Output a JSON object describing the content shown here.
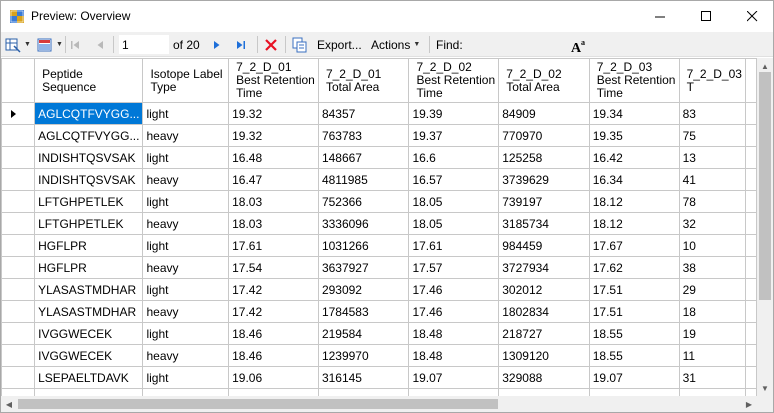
{
  "window": {
    "title": "Preview: Overview"
  },
  "toolbar": {
    "page_value": "1",
    "page_of": "of 20",
    "export_label": "Export...",
    "actions_label": "Actions",
    "find_label": "Find:"
  },
  "colors": {
    "selection": "#0078d7",
    "delete_red": "#e81123",
    "nav_blue": "#1e6fd9"
  },
  "grid": {
    "headers": [
      "Peptide Sequence",
      "Isotope Label Type",
      "7_2_D_01 Best Retention Time",
      "7_2_D_01 Total Area",
      "7_2_D_02 Best Retention Time",
      "7_2_D_02 Total Area",
      "7_2_D_03 Best Retention Time",
      "7_2_D_03 T"
    ],
    "rows": [
      [
        "AGLCQTFVYGG...",
        "light",
        "19.32",
        "84357",
        "19.39",
        "84909",
        "19.34",
        "83"
      ],
      [
        "AGLCQTFVYGG...",
        "heavy",
        "19.32",
        "763783",
        "19.37",
        "770970",
        "19.35",
        "75"
      ],
      [
        "INDISHTQSVSAK",
        "light",
        "16.48",
        "148667",
        "16.6",
        "125258",
        "16.42",
        "13"
      ],
      [
        "INDISHTQSVSAK",
        "heavy",
        "16.47",
        "4811985",
        "16.57",
        "3739629",
        "16.34",
        "41"
      ],
      [
        "LFTGHPETLEK",
        "light",
        "18.03",
        "752366",
        "18.05",
        "739197",
        "18.12",
        "78"
      ],
      [
        "LFTGHPETLEK",
        "heavy",
        "18.03",
        "3336096",
        "18.05",
        "3185734",
        "18.12",
        "32"
      ],
      [
        "HGFLPR",
        "light",
        "17.61",
        "1031266",
        "17.61",
        "984459",
        "17.67",
        "10"
      ],
      [
        "HGFLPR",
        "heavy",
        "17.54",
        "3637927",
        "17.57",
        "3727934",
        "17.62",
        "38"
      ],
      [
        "YLASASTMDHAR",
        "light",
        "17.42",
        "293092",
        "17.46",
        "302012",
        "17.51",
        "29"
      ],
      [
        "YLASASTMDHAR",
        "heavy",
        "17.42",
        "1784583",
        "17.46",
        "1802834",
        "17.51",
        "18"
      ],
      [
        "IVGGWECEK",
        "light",
        "18.46",
        "219584",
        "18.48",
        "218727",
        "18.55",
        "19"
      ],
      [
        "IVGGWECEK",
        "heavy",
        "18.46",
        "1239970",
        "18.48",
        "1309120",
        "18.55",
        "11"
      ],
      [
        "LSEPAELTDAVK",
        "light",
        "19.06",
        "316145",
        "19.07",
        "329088",
        "19.07",
        "31"
      ],
      [
        "",
        "",
        "",
        "",
        "",
        "",
        "",
        ""
      ]
    ]
  }
}
